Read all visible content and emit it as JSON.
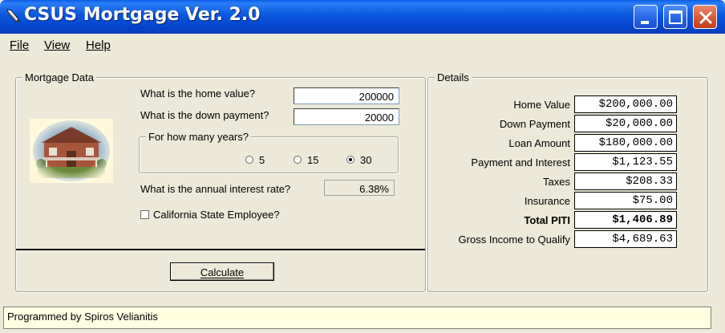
{
  "window": {
    "title": "CSUS Mortgage Ver. 2.0",
    "icon": "pencil-icon",
    "controls": [
      "minimize-icon",
      "maximize-icon",
      "close-icon"
    ]
  },
  "menu": {
    "file": "File",
    "view": "View",
    "help": "Help"
  },
  "mortgage": {
    "legend": "Mortgage Data",
    "home_value_label": "What is the home value?",
    "home_value": "200000",
    "down_payment_label": "What is the down payment?",
    "down_payment": "20000",
    "years_legend": "For how many years?",
    "years_options": [
      "5",
      "15",
      "30"
    ],
    "years_selected": "30",
    "rate_label": "What is the annual interest rate?",
    "rate": "6.38%",
    "employee_label": "California State Employee?",
    "employee_checked": false,
    "calculate_label": "Calculate",
    "image": "house-photo"
  },
  "details": {
    "legend": "Details",
    "rows": [
      {
        "label": "Home Value",
        "value": "$200,000.00",
        "bold": false
      },
      {
        "label": "Down Payment",
        "value": "$20,000.00",
        "bold": false
      },
      {
        "label": "Loan Amount",
        "value": "$180,000.00",
        "bold": false
      },
      {
        "label": "Payment and Interest",
        "value": "$1,123.55",
        "bold": false
      },
      {
        "label": "Taxes",
        "value": "$208.33",
        "bold": false
      },
      {
        "label": "Insurance",
        "value": "$75.00",
        "bold": false
      },
      {
        "label": "Total PITI",
        "value": "$1,406.89",
        "bold": true
      },
      {
        "label": "Gross Income to Qualify",
        "value": "$4,689.63",
        "bold": false
      }
    ]
  },
  "status": {
    "text": "Programmed by Spiros Velianitis"
  }
}
